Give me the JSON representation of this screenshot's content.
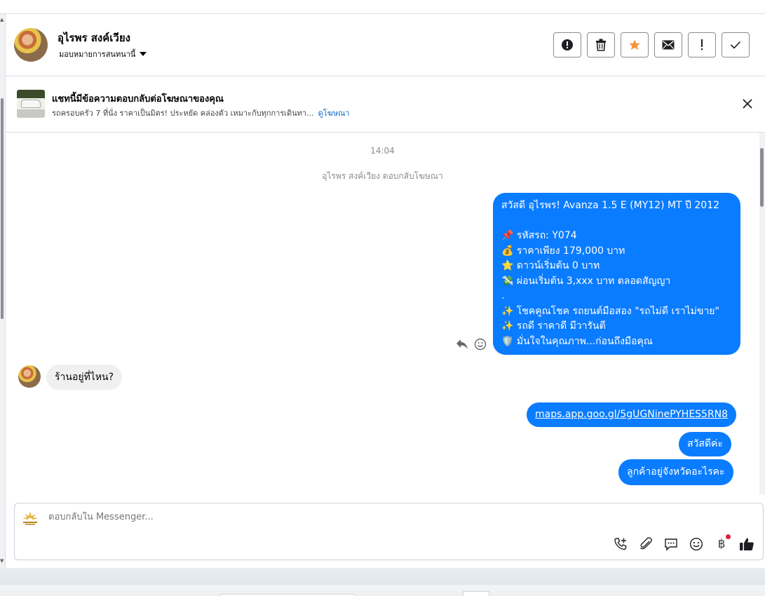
{
  "header": {
    "contact_name": "อุไรพร สงค์เวียง",
    "assign_label": "มอบหมายการสนทนานี้",
    "actions": [
      {
        "name": "spam-button",
        "icon": "alert-circle-icon"
      },
      {
        "name": "delete-button",
        "icon": "trash-icon"
      },
      {
        "name": "star-button",
        "icon": "star-icon"
      },
      {
        "name": "mark-unread-button",
        "icon": "envelope-icon"
      },
      {
        "name": "follow-up-button",
        "icon": "exclamation-icon"
      },
      {
        "name": "mark-done-button",
        "icon": "checkmark-icon"
      }
    ],
    "star_color": "#f7923b"
  },
  "ad_banner": {
    "title": "แชทนี้มีข้อความตอบกลับต่อโฆษณาของคุณ",
    "subtitle": "รถครอบครัว 7 ที่นั่ง ราคาเป็นมิตร! ประหยัด คล่องตัว เหมาะกับทุกการเดินทา...",
    "link": "ดูโฆษณา"
  },
  "thread": {
    "timestamp": "14:04",
    "system_message": "อุไรพร สงค์เวียง ตอบกลับโฆษณา",
    "outgoing_ad_message": [
      "สวัสดี อุไรพร! Avanza 1.5 E (MY12) MT ปี 2012",
      "",
      "📌 รหัสรถ: Y074",
      "💰 ราคาเพียง 179,000 บาท",
      "⭐ ดาวน์เริ่มต้น 0 บาท",
      "💸 ผ่อนเริ่มต้น 3,xxx บาท ตลอดสัญญา",
      ".",
      "✨ โชคคูณโชค รถยนต์มือสอง \"รถไม่ดี เราไม่ขาย\"",
      "✨ รถดี ราคาดี มีวารันตี",
      "🛡️ มั่นใจในคุณภาพ...ก่อนถึงมือคุณ"
    ],
    "incoming_message": "ร้านอยู่ที่ไหน?",
    "outgoing_link": "maps.app.goo.gl/5gUGNinePYHES5RN8",
    "outgoing_greeting": "สวัสดีค่ะ",
    "outgoing_question": "ลูกค้าอยู่จังหวัดอะไรคะ",
    "bubble_color": "#0a7cff"
  },
  "composer": {
    "placeholder": "ตอบกลับใน Messenger...",
    "tools": [
      "add-call-icon",
      "attachment-icon",
      "saved-replies-icon",
      "emoji-icon",
      "payment-icon",
      "like-icon"
    ],
    "baht_symbol": "฿"
  }
}
